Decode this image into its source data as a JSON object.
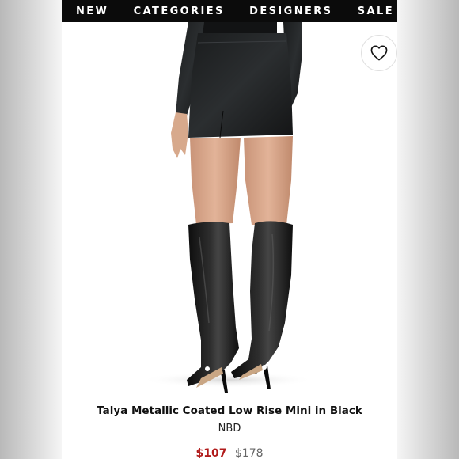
{
  "nav": {
    "items": [
      {
        "label": "NEW"
      },
      {
        "label": "CATEGORIES"
      },
      {
        "label": "DESIGNERS"
      },
      {
        "label": "SALE"
      }
    ]
  },
  "product": {
    "title": "Talya Metallic Coated Low Rise Mini in Black",
    "brand": "NBD",
    "sale_price": "$107",
    "original_price": "$178"
  },
  "icons": {
    "wishlist": "heart-outline-icon"
  }
}
